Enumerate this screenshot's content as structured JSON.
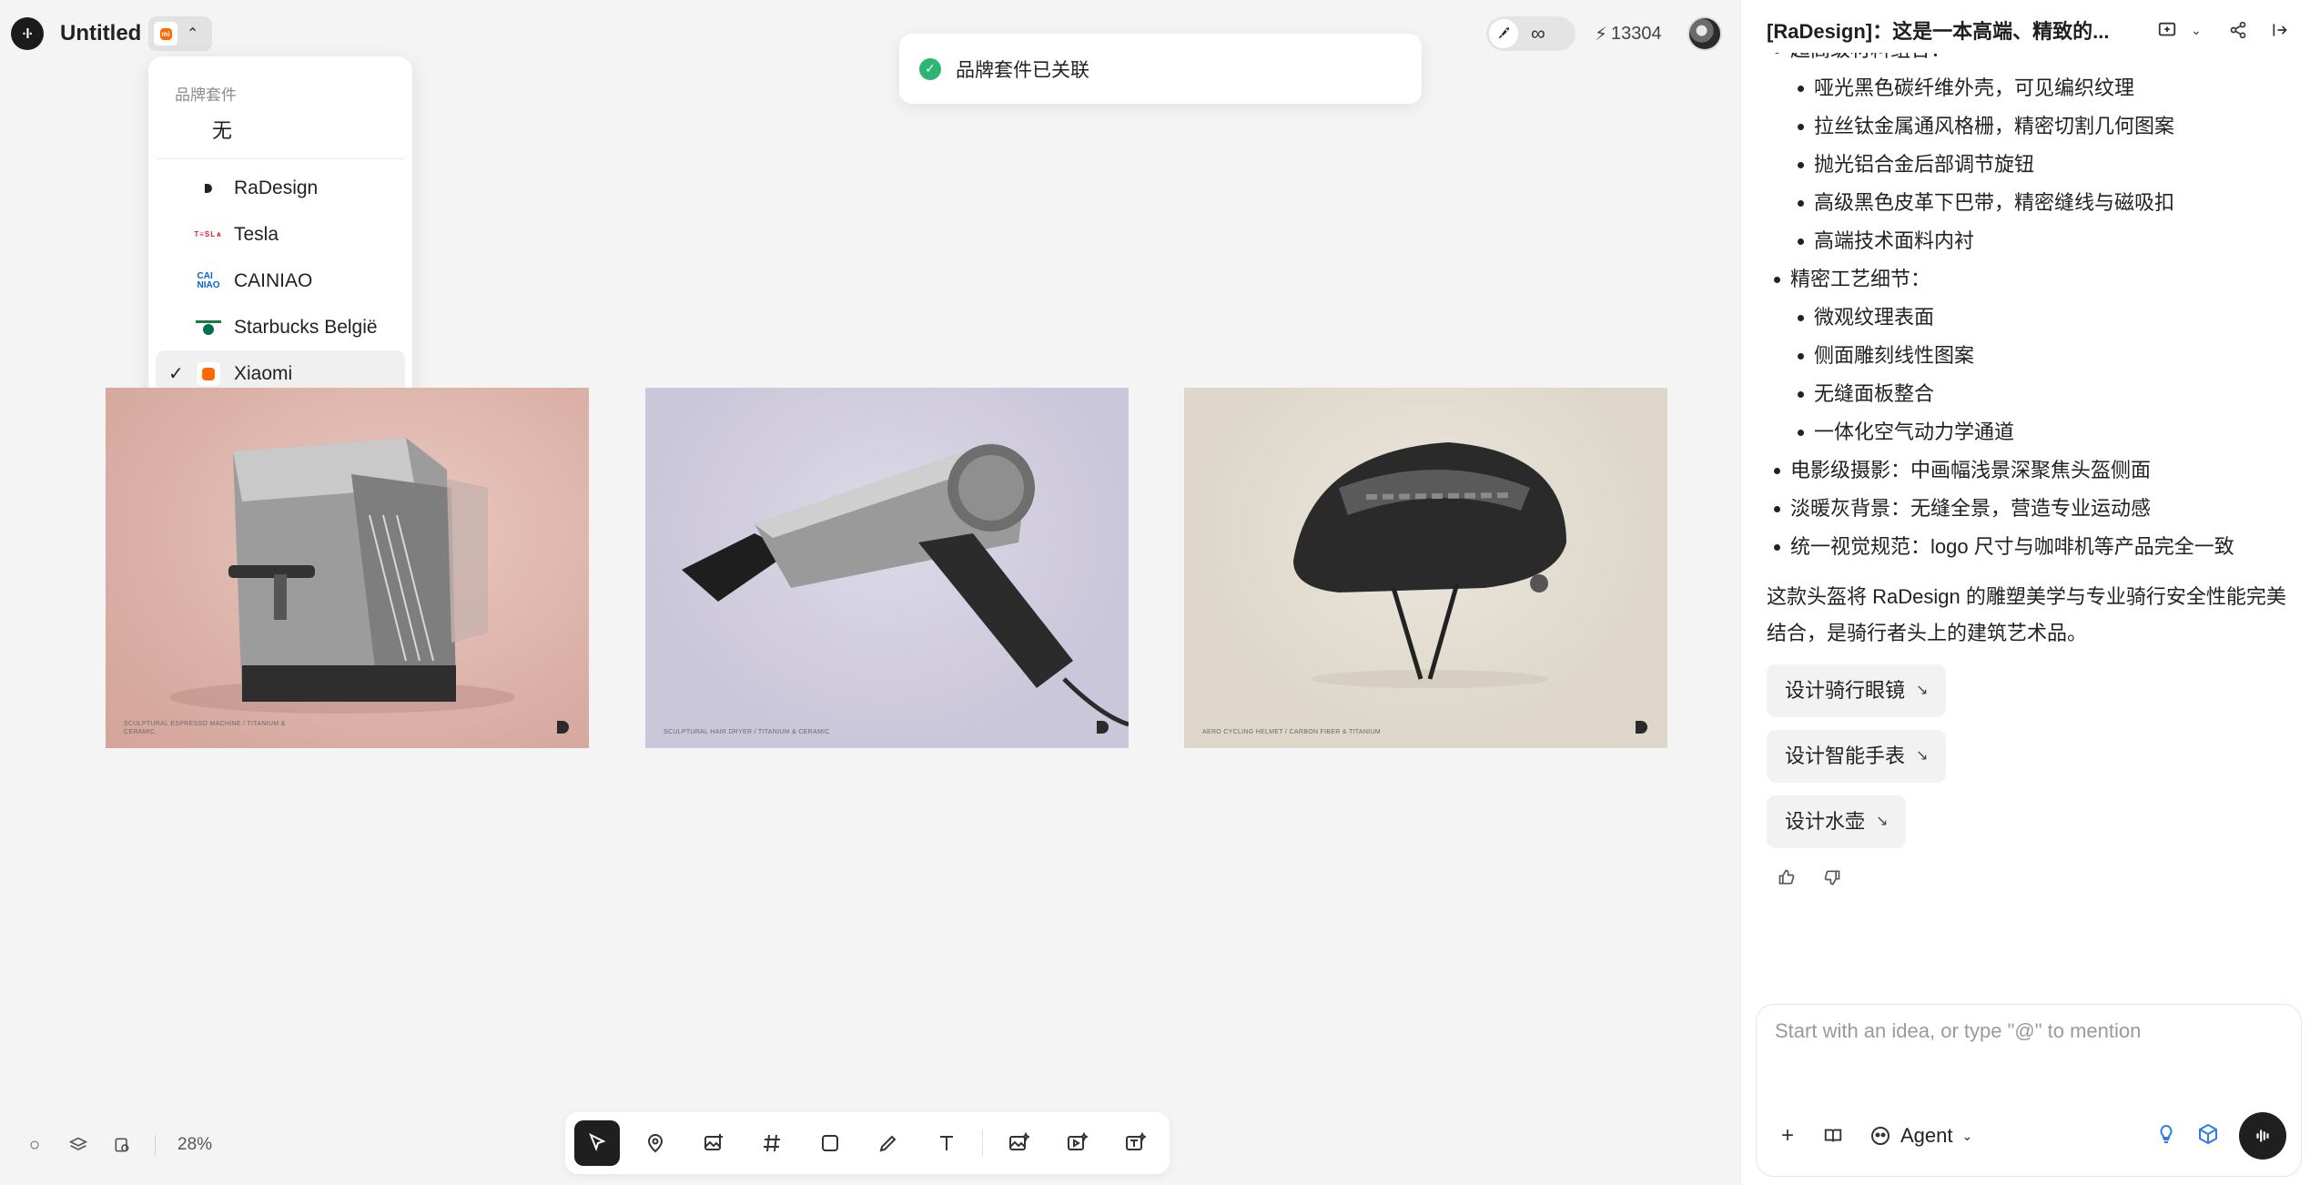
{
  "header": {
    "title": "Untitled",
    "credits": "13304"
  },
  "brand_dropdown": {
    "header": "品牌套件",
    "none_label": "无",
    "items": [
      {
        "label": "RaDesign",
        "icon": "radesign-logo"
      },
      {
        "label": "Tesla",
        "icon": "tesla-logo"
      },
      {
        "label": "CAINIAO",
        "icon": "cainiao-logo"
      },
      {
        "label": "Starbucks België",
        "icon": "starbucks-logo"
      },
      {
        "label": "Xiaomi",
        "icon": "xiaomi-logo",
        "selected": true
      }
    ]
  },
  "toast": {
    "message": "品牌套件已关联"
  },
  "cards": [
    {
      "caption": "SCULPTURAL ESPRESSO MACHINE / TITANIUM & CERAMIC"
    },
    {
      "caption": "SCULPTURAL HAIR DRYER / TITANIUM & CERAMIC"
    },
    {
      "caption": "AERO CYCLING HELMET / CARBON FIBER & TITANIUM"
    }
  ],
  "canvas": {
    "zoom": "28%"
  },
  "panel": {
    "title": "[RaDesign]：这是一本高端、精致的...",
    "cut_item": "超高级材料组合：",
    "materials": [
      "哑光黑色碳纤维外壳，可见编织纹理",
      "拉丝钛金属通风格栅，精密切割几何图案",
      "抛光铝合金后部调节旋钮",
      "高级黑色皮革下巴带，精密缝线与磁吸扣",
      "高端技术面料内衬"
    ],
    "craft_title": "精密工艺细节：",
    "craft": [
      "微观纹理表面",
      "侧面雕刻线性图案",
      "无缝面板整合",
      "一体化空气动力学通道"
    ],
    "bullets": [
      "电影级摄影：中画幅浅景深聚焦头盔侧面",
      "淡暖灰背景：无缝全景，营造专业运动感",
      "统一视觉规范：logo 尺寸与咖啡机等产品完全一致"
    ],
    "paragraph": "这款头盔将 RaDesign 的雕塑美学与专业骑行安全性能完美结合，是骑行者头上的建筑艺术品。",
    "suggestions": [
      "设计骑行眼镜",
      "设计智能手表",
      "设计水壶"
    ]
  },
  "chat": {
    "placeholder": "Start with an idea, or type \"@\" to mention",
    "agent_label": "Agent"
  },
  "colors": {
    "accent_dark": "#1f1f1f",
    "success": "#2bb673",
    "xiaomi_orange": "#ff6900"
  }
}
